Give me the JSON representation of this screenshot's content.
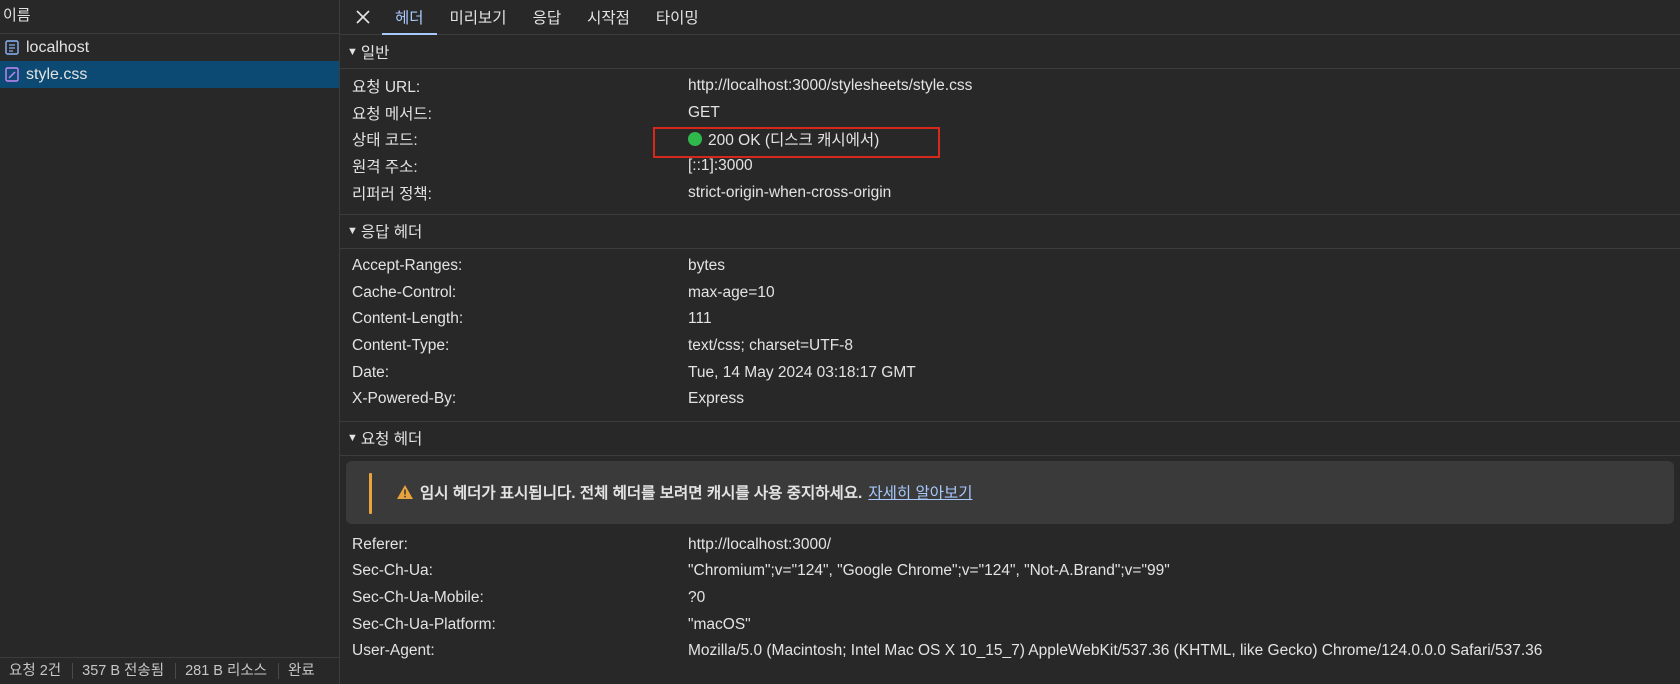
{
  "sidebar": {
    "header": "이름",
    "requests": [
      {
        "name": "localhost",
        "icon": "document-icon"
      },
      {
        "name": "style.css",
        "icon": "stylesheet-icon"
      }
    ]
  },
  "statusbar": {
    "requests": "요청 2건",
    "transferred": "357 B 전송됨",
    "resources": "281 B 리소스",
    "finish": "완료"
  },
  "tabs": [
    "헤더",
    "미리보기",
    "응답",
    "시작점",
    "타이밍"
  ],
  "general": {
    "title": "일반",
    "rows": [
      {
        "k": "요청 URL:",
        "v": "http://localhost:3000/stylesheets/style.css"
      },
      {
        "k": "요청 메서드:",
        "v": "GET"
      },
      {
        "k": "상태 코드:",
        "v": "200 OK (디스크 캐시에서)"
      },
      {
        "k": "원격 주소:",
        "v": "[::1]:3000"
      },
      {
        "k": "리퍼러 정책:",
        "v": "strict-origin-when-cross-origin"
      }
    ]
  },
  "response_headers": {
    "title": "응답 헤더",
    "rows": [
      {
        "k": "Accept-Ranges:",
        "v": "bytes"
      },
      {
        "k": "Cache-Control:",
        "v": "max-age=10"
      },
      {
        "k": "Content-Length:",
        "v": "111"
      },
      {
        "k": "Content-Type:",
        "v": "text/css; charset=UTF-8"
      },
      {
        "k": "Date:",
        "v": "Tue, 14 May 2024 03:18:17 GMT"
      },
      {
        "k": "X-Powered-By:",
        "v": "Express"
      }
    ]
  },
  "request_headers": {
    "title": "요청 헤더",
    "warning": "임시 헤더가 표시됩니다. 전체 헤더를 보려면 캐시를 사용 중지하세요.",
    "warning_link": "자세히 알아보기",
    "rows": [
      {
        "k": "Referer:",
        "v": "http://localhost:3000/"
      },
      {
        "k": "Sec-Ch-Ua:",
        "v": "\"Chromium\";v=\"124\", \"Google Chrome\";v=\"124\", \"Not-A.Brand\";v=\"99\""
      },
      {
        "k": "Sec-Ch-Ua-Mobile:",
        "v": "?0"
      },
      {
        "k": "Sec-Ch-Ua-Platform:",
        "v": "\"macOS\""
      },
      {
        "k": "User-Agent:",
        "v": "Mozilla/5.0 (Macintosh; Intel Mac OS X 10_15_7) AppleWebKit/537.36 (KHTML, like Gecko) Chrome/124.0.0.0 Safari/537.36"
      }
    ]
  },
  "colors": {
    "accent": "#a8c7fa",
    "status_ok": "#2fb84c",
    "highlight": "#d6291c",
    "warning": "#e8a33d"
  }
}
